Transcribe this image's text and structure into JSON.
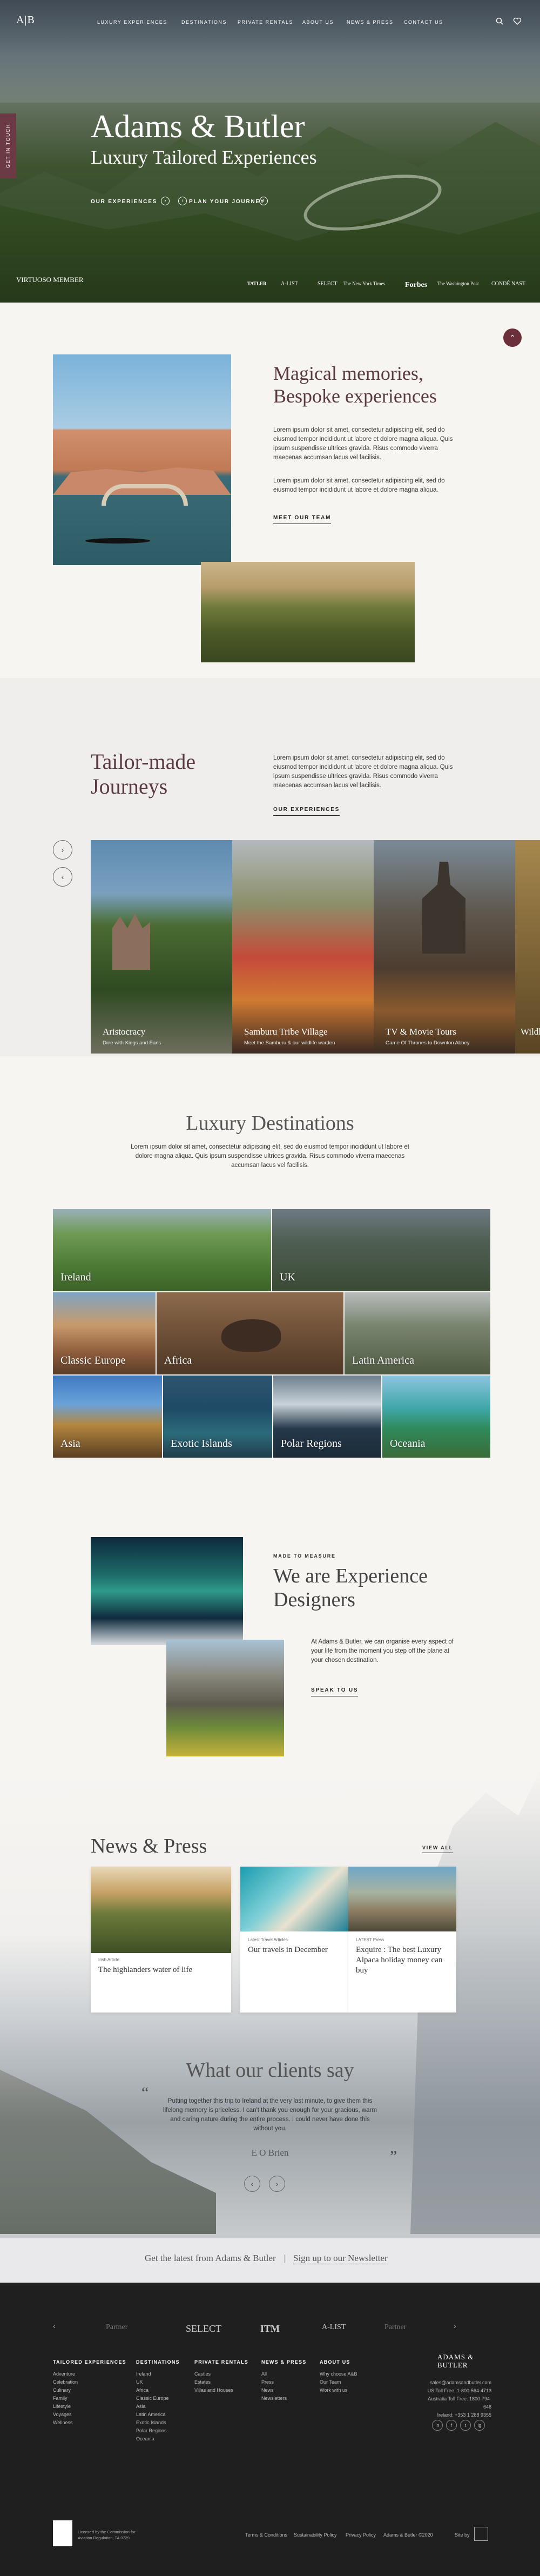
{
  "nav": {
    "logo": "A|B",
    "links": [
      "LUXURY EXPERIENCES",
      "DESTINATIONS",
      "PRIVATE RENTALS",
      "ABOUT US",
      "NEWS & PRESS",
      "CONTACT US"
    ],
    "side_tab": "GET IN TOUCH"
  },
  "hero": {
    "title": "Adams & Butler",
    "subtitle": "Luxury Tailored Experiences",
    "cta1": "OUR EXPERIENCES",
    "cta2": "PLAN YOUR JOURNEY",
    "virtuoso": "VIRTUOSO MEMBER",
    "partners": [
      "TATLER",
      "A-LIST",
      "SELECT",
      "The New York Times",
      "Forbes",
      "The Washington Post",
      "CONDÉ NAST"
    ]
  },
  "intro": {
    "title_line1": "Magical memories,",
    "title_line2": "Bespoke experiences",
    "p1": "Lorem ipsum dolor sit amet, consectetur adipiscing elit, sed do eiusmod tempor incididunt ut labore et dolore magna aliqua. Quis ipsum suspendisse ultrices gravida. Risus commodo viverra maecenas accumsan lacus vel facilisis.",
    "p2": "Lorem ipsum dolor sit amet, consectetur adipiscing elit, sed do eiusmod tempor incididunt ut labore et dolore magna aliqua.",
    "cta": "MEET OUR TEAM"
  },
  "tailor": {
    "title_line1": "Tailor-made",
    "title_line2": "Journeys",
    "text": "Lorem ipsum dolor sit amet, consectetur adipiscing elit, sed do eiusmod tempor incididunt ut labore et dolore magna aliqua. Quis ipsum suspendisse ultrices gravida. Risus commodo viverra maecenas accumsan lacus vel facilisis.",
    "cta": "OUR EXPERIENCES",
    "cards": [
      {
        "title": "Aristocracy",
        "desc": "Dine with Kings and Earls"
      },
      {
        "title": "Samburu Tribe Village",
        "desc": "Meet the Samburu & our wildlife warden"
      },
      {
        "title": "TV & Movie Tours",
        "desc": "Game Of Thrones to Downton Abbey"
      },
      {
        "title": "Wildlife",
        "desc": ""
      }
    ]
  },
  "destinations": {
    "title": "Luxury Destinations",
    "text": "Lorem ipsum dolor sit amet, consectetur adipiscing elit, sed do eiusmod tempor incididunt ut labore et dolore magna aliqua. Quis ipsum suspendisse ultrices gravida. Risus commodo viverra maecenas accumsan lacus vel facilisis.",
    "tiles": [
      "Ireland",
      "UK",
      "Classic Europe",
      "Africa",
      "Latin America",
      "Asia",
      "Exotic Islands",
      "Polar Regions",
      "Oceania"
    ]
  },
  "experience": {
    "eyebrow": "MADE TO MEASURE",
    "title_line1": "We are Experience",
    "title_line2": "Designers",
    "text": "At Adams & Butler, we can organise every aspect of your life from the moment you step off the plane at your chosen destination.",
    "cta": "SPEAK TO US"
  },
  "news": {
    "title": "News & Press",
    "view_all": "VIEW ALL",
    "cards": [
      {
        "tag": "Irish Article",
        "title": "The highlanders water of life"
      },
      {
        "tag": "Latest Travel Articles",
        "title": "Our travels in December"
      },
      {
        "tag": "LATEST Press",
        "title": "Exquire : The best Luxury Alpaca holiday money can buy"
      }
    ]
  },
  "testimonial": {
    "title": "What our clients say",
    "quote": "Putting together this trip to Ireland at the very last minute, to give them this lifelong memory is priceless. I can't thank you enough for your gracious, warm and caring nature during the entire process. I could never have done this without you.",
    "author": "E O Brien"
  },
  "newsletter": {
    "text": "Get the latest from Adams & Butler",
    "link": "Sign up to our Newsletter"
  },
  "footer": {
    "partner_logos": [
      "Partner",
      "SELECT",
      "ITM",
      "A-LIST",
      "Partner"
    ],
    "columns": [
      {
        "heading": "TAILORED EXPERIENCES",
        "links": [
          "Adventure",
          "Celebration",
          "Culinary",
          "Family",
          "Lifestyle",
          "Voyages",
          "Wellness"
        ]
      },
      {
        "heading": "DESTINATIONS",
        "links": [
          "Ireland",
          "UK",
          "Africa",
          "Classic Europe",
          "Asia",
          "Latin America",
          "Exotic Islands",
          "Polar Regions",
          "Oceania"
        ]
      },
      {
        "heading": "PRIVATE RENTALS",
        "links": [
          "Castles",
          "Estates",
          "Villas and Houses"
        ]
      },
      {
        "heading": "NEWS & PRESS",
        "links": [
          "All",
          "Press",
          "News",
          "Newsletters"
        ]
      },
      {
        "heading": "ABOUT US",
        "links": [
          "Why choose A&B",
          "Our Team",
          "Work with us"
        ]
      }
    ],
    "brand": "ADAMS & BUTLER",
    "contact": [
      "sales@adamsandbutler.com",
      "US Toll Free: 1-800-564-4713",
      "Australia Toll Free: 1800-794-646",
      "Ireland: +353 1 288 9355"
    ],
    "socials": [
      "in",
      "f",
      "t",
      "ig"
    ],
    "licence": "Licensed by the Commission for Aviation Regulation, TA 0729",
    "legal": [
      "Terms & Conditions",
      "Sustainability Policy",
      "Privacy Policy",
      "Adams & Butler ©2020"
    ],
    "site_by": "Site by"
  }
}
